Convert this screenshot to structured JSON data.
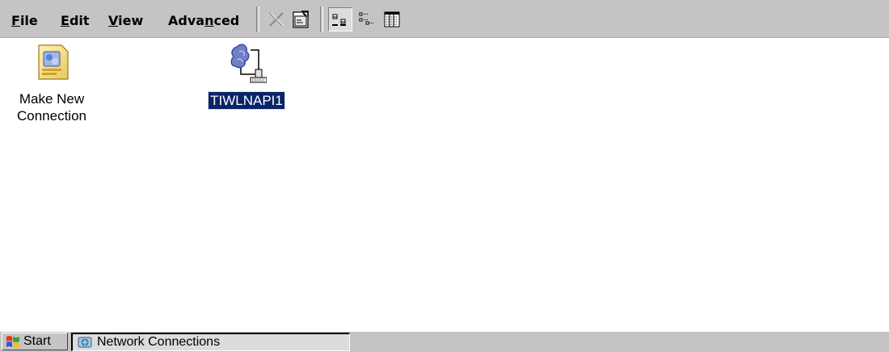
{
  "menu": {
    "file": {
      "pre": "",
      "accel": "F",
      "post": "ile"
    },
    "edit": {
      "pre": "",
      "accel": "E",
      "post": "dit"
    },
    "view": {
      "pre": "",
      "accel": "V",
      "post": "iew"
    },
    "advanced": {
      "pre": "Adva",
      "accel": "n",
      "post": "ced"
    }
  },
  "toolbar": {
    "icons": [
      "delete-icon",
      "properties-icon",
      "large-icons-view-icon",
      "small-icons-view-icon",
      "details-view-icon"
    ]
  },
  "items": [
    {
      "label": "Make New\nConnection",
      "icon": "make-new-connection-icon",
      "selected": false
    },
    {
      "label": "TIWLNAPI1",
      "icon": "network-adapter-icon",
      "selected": true
    }
  ],
  "taskbar": {
    "start_label": "Start",
    "window_label": "Network Connections"
  },
  "colors": {
    "chrome": "#c6c3c6",
    "selection": "#0a246a",
    "background": "#ffffff"
  }
}
